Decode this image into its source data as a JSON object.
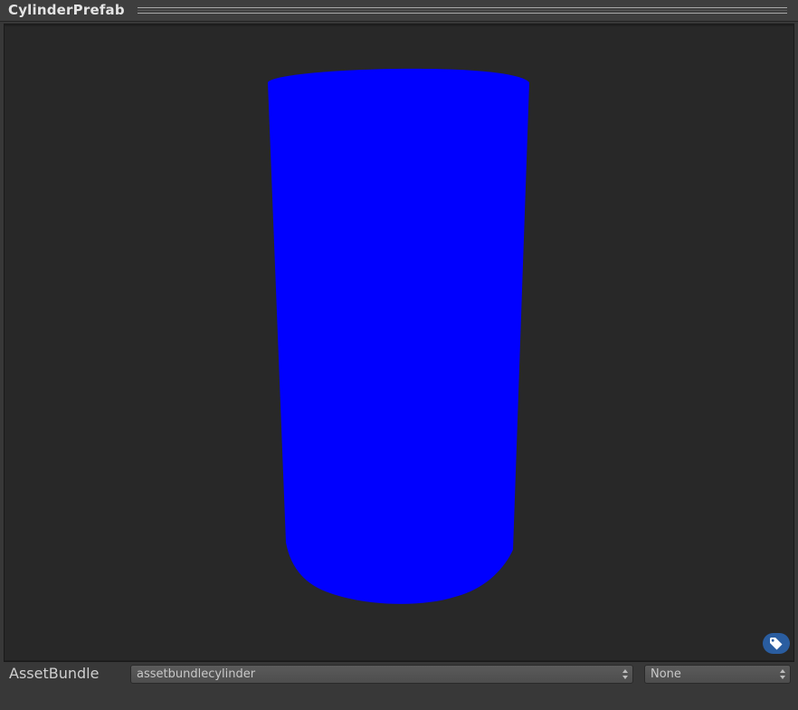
{
  "window": {
    "title": "CylinderPrefab"
  },
  "preview": {
    "object_color": "#0000ff",
    "background_color": "#282828",
    "label_button_icon": "tag-icon"
  },
  "asset_bundle": {
    "label": "AssetBundle",
    "name_value": "assetbundlecylinder",
    "variant_value": "None"
  }
}
